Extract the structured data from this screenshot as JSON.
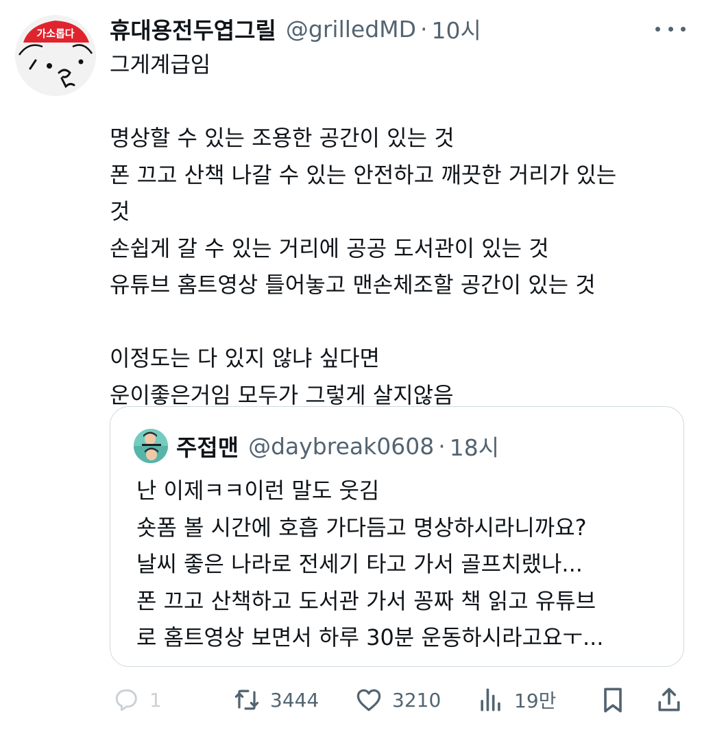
{
  "tweet": {
    "display_name": "휴대용전두엽그릴",
    "handle": "@grilledMD",
    "separator": "·",
    "time": "10시",
    "avatar_text": "가소롭다",
    "lines": [
      "그게계급임",
      "",
      "명상할 수 있는 조용한 공간이 있는 것",
      "폰 끄고 산책 나갈 수 있는 안전하고 깨끗한 거리가 있는",
      "것",
      "손쉽게 갈 수 있는 거리에 공공 도서관이 있는 것",
      "유튜브 홈트영상 틀어놓고 맨손체조할 공간이 있는 것",
      "",
      "이정도는 다 있지 않냐 싶다면",
      "운이좋은거임 모두가 그렇게 살지않음"
    ]
  },
  "quoted_tweet": {
    "display_name": "주접맨",
    "handle": "@daybreak0608",
    "separator": "·",
    "time": "18시",
    "lines": [
      "난 이제ㅋㅋ이런 말도 웃김",
      "숏폼 볼 시간에 호흡 가다듬고 명상하시라니까요?",
      "날씨 좋은 나라로 전세기 타고 가서 골프치랬나...",
      "폰 끄고 산책하고 도서관 가서 꽁짜 책 읽고 유튜브",
      "로 홈트영상 보면서 하루 30분 운동하시라고요ㅜ..."
    ]
  },
  "actions": {
    "reply_count": "1",
    "retweet_count": "3444",
    "like_count": "3210",
    "views_count": "19만"
  },
  "icons": {
    "more": "more-dots-icon",
    "reply": "reply-icon",
    "retweet": "retweet-icon",
    "like": "heart-icon",
    "views": "views-bar-chart-icon",
    "bookmark": "bookmark-icon",
    "share": "share-icon"
  },
  "colors": {
    "text": "#0f1419",
    "secondary": "#536471",
    "border": "#cfd9de",
    "avatar_badge": "#e0242e"
  }
}
